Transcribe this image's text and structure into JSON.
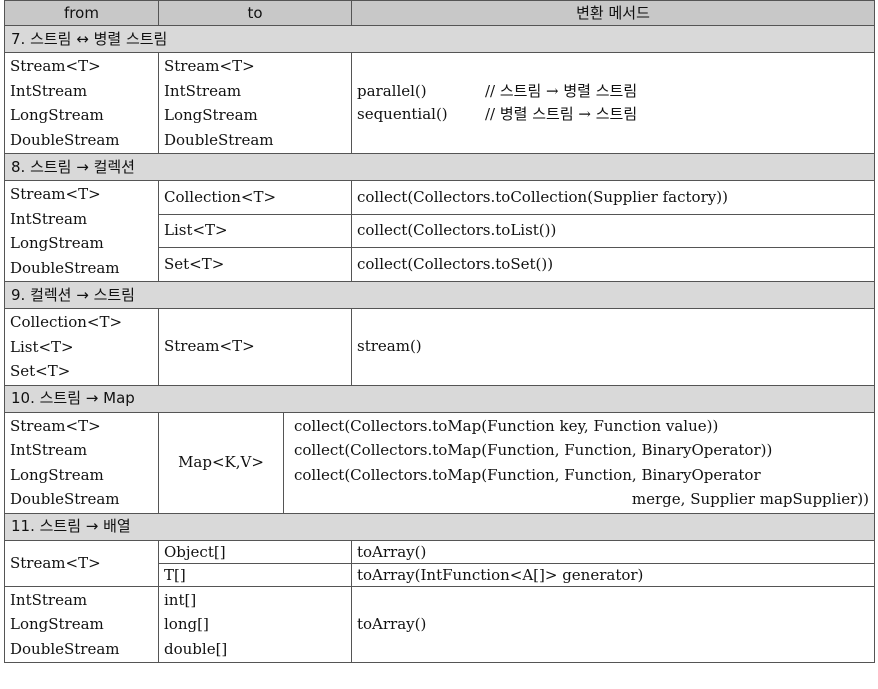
{
  "headers": {
    "from": "from",
    "to": "to",
    "method": "변환 메서드"
  },
  "sections": {
    "s7": {
      "title": "7. 스트림 ↔ 병렬 스트림",
      "from": [
        "Stream<T>",
        "IntStream",
        "LongStream",
        "DoubleStream"
      ],
      "to": [
        "Stream<T>",
        "IntStream",
        "LongStream",
        "DoubleStream"
      ],
      "methods": [
        {
          "call": "parallel()",
          "comment": "// 스트림 → 병렬 스트림"
        },
        {
          "call": "sequential()",
          "comment": "// 병렬 스트림 → 스트림"
        }
      ]
    },
    "s8": {
      "title": "8. 스트림 → 컬렉션",
      "from": [
        "Stream<T>",
        "IntStream",
        "LongStream",
        "DoubleStream"
      ],
      "rows": [
        {
          "to": "Collection<T>",
          "method": "collect(Collectors.toCollection(Supplier factory))"
        },
        {
          "to": "List<T>",
          "method": "collect(Collectors.toList())"
        },
        {
          "to": "Set<T>",
          "method": "collect(Collectors.toSet())"
        }
      ]
    },
    "s9": {
      "title": "9. 컬렉션 → 스트림",
      "from": [
        "Collection<T>",
        "List<T>",
        "Set<T>"
      ],
      "to": "Stream<T>",
      "method": "stream()"
    },
    "s10": {
      "title": "10. 스트림 → Map",
      "from": [
        "Stream<T>",
        "IntStream",
        "LongStream",
        "DoubleStream"
      ],
      "to": "Map<K,V>",
      "methods": [
        "collect(Collectors.toMap(Function key, Function value))",
        "collect(Collectors.toMap(Function, Function, BinaryOperator))",
        "collect(Collectors.toMap(Function, Function, BinaryOperator",
        "merge, Supplier mapSupplier))"
      ]
    },
    "s11": {
      "title": "11. 스트림 → 배열",
      "from_a": "Stream<T>",
      "rows_a": [
        {
          "to": "Object[]",
          "method": "toArray()"
        },
        {
          "to": "T[]",
          "method": "toArray(IntFunction<A[]> generator)"
        }
      ],
      "from_b": [
        "IntStream",
        "LongStream",
        "DoubleStream"
      ],
      "to_b": [
        "int[]",
        "long[]",
        "double[]"
      ],
      "method_b": "toArray()"
    }
  }
}
